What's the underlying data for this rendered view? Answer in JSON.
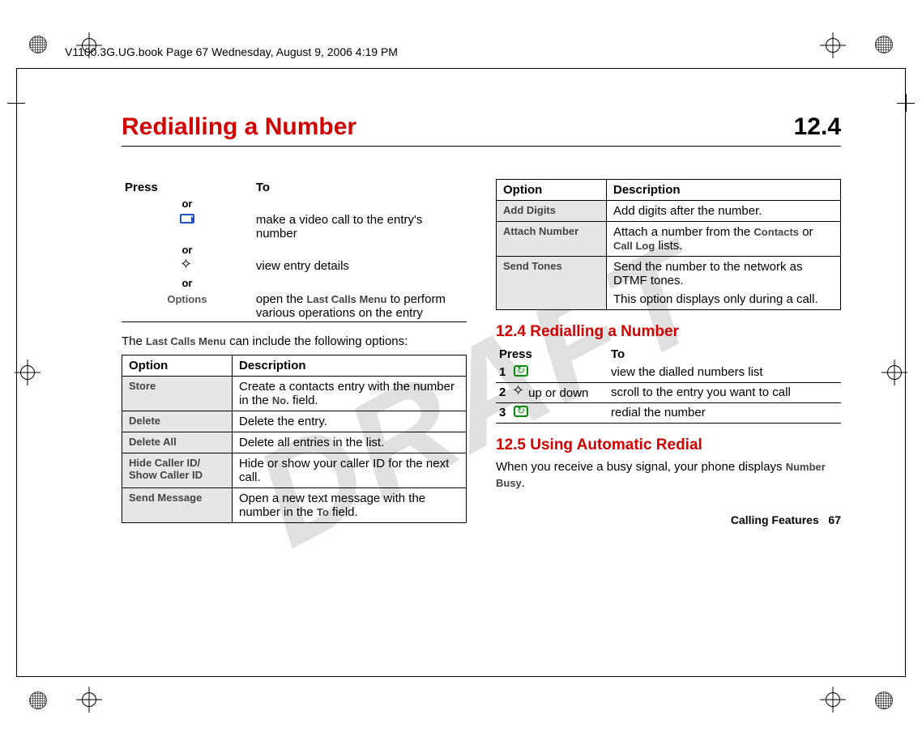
{
  "frameHeader": "V1100.3G.UG.book  Page 67  Wednesday, August 9, 2006  4:19 PM",
  "watermark": "DRAFT",
  "chapter": {
    "title": "Redialling a Number",
    "number": "12.4"
  },
  "leftCol": {
    "pressToHeader": {
      "press": "Press",
      "to": "To"
    },
    "rows": [
      {
        "key": "or",
        "type": "or"
      },
      {
        "key": "video",
        "type": "icon",
        "desc": "make a video call to the entry's number"
      },
      {
        "key": "or",
        "type": "or"
      },
      {
        "key": "nav",
        "type": "icon",
        "desc": "view entry details"
      },
      {
        "key": "or",
        "type": "or"
      },
      {
        "key": "Options",
        "type": "softkey",
        "desc_pre": "open the ",
        "desc_bold": "Last Calls Menu",
        "desc_post": " to perform various operations on the entry"
      }
    ],
    "intro_pre": "The ",
    "intro_bold": "Last Calls Menu",
    "intro_post": " can include the following options:",
    "optHeader": {
      "opt": "Option",
      "desc": "Description"
    },
    "options": [
      {
        "opt": "Store",
        "desc_pre": "Create a contacts entry with the number in the ",
        "desc_bold": "No.",
        "desc_post": " field."
      },
      {
        "opt": "Delete",
        "desc": "Delete the entry."
      },
      {
        "opt": "Delete All",
        "desc": "Delete all entries in the list."
      },
      {
        "opt": "Hide Caller ID/",
        "opt2": "Show Caller ID",
        "desc": "Hide or show your caller ID for the next call."
      },
      {
        "opt": "Send Message",
        "desc_pre": "Open a new text message with the number in the ",
        "desc_bold": "To",
        "desc_post": " field."
      }
    ]
  },
  "rightCol": {
    "optHeader": {
      "opt": "Option",
      "desc": "Description"
    },
    "options": [
      {
        "opt": "Add Digits",
        "desc": "Add digits after the number."
      },
      {
        "opt": "Attach Number",
        "desc_pre": "Attach a number from the ",
        "desc_bold": "Contacts",
        "desc_mid": " or ",
        "desc_bold2": "Call Log",
        "desc_post": " lists."
      },
      {
        "opt": "Send Tones",
        "desc": "Send the number to the network as DTMF tones.",
        "desc_p2": "This option displays only during a call."
      }
    ],
    "section124": "12.4 Redialling a Number",
    "pt2Header": {
      "press": "Press",
      "to": "To"
    },
    "steps": [
      {
        "n": "1",
        "icon": "send",
        "desc": "view the dialled numbers list"
      },
      {
        "n": "2",
        "icon": "nav2",
        "extra": " up or down",
        "desc": "scroll to the entry you want to call"
      },
      {
        "n": "3",
        "icon": "send",
        "desc": "redial the number"
      }
    ],
    "section125": "12.5 Using Automatic Redial",
    "busy_pre": "When you receive a busy signal, your phone displays ",
    "busy_bold": "Number Busy",
    "busy_post": "."
  },
  "footer": {
    "section": "Calling Features",
    "page": "67"
  }
}
